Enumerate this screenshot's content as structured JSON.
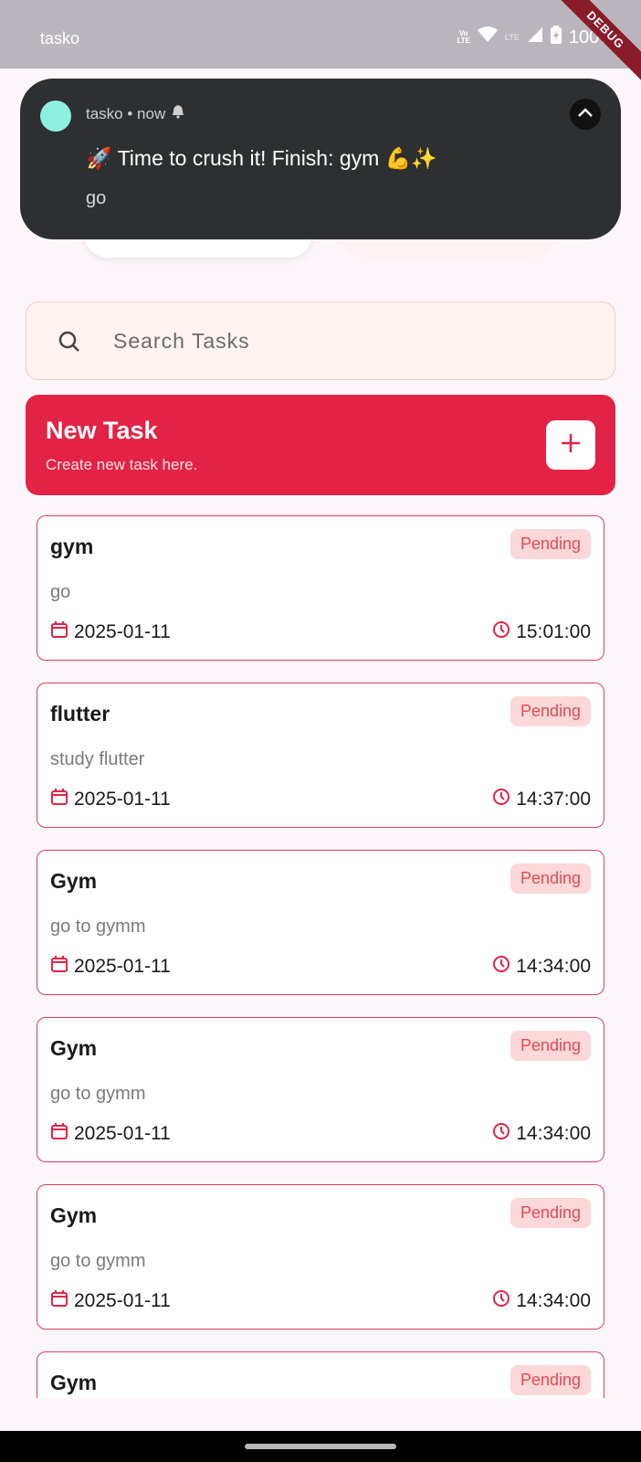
{
  "status_bar": {
    "app_name": "tasko",
    "battery": "100%",
    "volte_top": "Vo",
    "volte_bottom": "LTE",
    "lte_label": "LTE",
    "debug_label": "DEBUG"
  },
  "notification": {
    "meta": "tasko • now",
    "title": "🚀 Time to crush it! Finish: gym 💪✨",
    "body": "go",
    "avatar_color": "#8ef0df"
  },
  "search": {
    "placeholder": "Search Tasks"
  },
  "new_task": {
    "title": "New Task",
    "subtitle": "Create new task here."
  },
  "tasks": [
    {
      "title": "gym",
      "status": "Pending",
      "description": "go",
      "date": "2025-01-11",
      "time": "15:01:00"
    },
    {
      "title": "flutter",
      "status": "Pending",
      "description": "study flutter",
      "date": "2025-01-11",
      "time": "14:37:00"
    },
    {
      "title": "Gym",
      "status": "Pending",
      "description": "go to gymm",
      "date": "2025-01-11",
      "time": "14:34:00"
    },
    {
      "title": "Gym",
      "status": "Pending",
      "description": "go to gymm",
      "date": "2025-01-11",
      "time": "14:34:00"
    },
    {
      "title": "Gym",
      "status": "Pending",
      "description": "go to gymm",
      "date": "2025-01-11",
      "time": "14:34:00"
    },
    {
      "title": "Gym",
      "status": "Pending",
      "description": "",
      "date": "",
      "time": ""
    }
  ],
  "colors": {
    "accent": "#e22345",
    "card_border": "#dc3f5b",
    "badge_bg": "#fcd8d8",
    "badge_text": "#e14a57"
  },
  "icons": [
    "search-icon",
    "plus-icon",
    "calendar-icon",
    "clock-icon",
    "chevron-up-icon",
    "bell-icon",
    "wifi-icon",
    "signal-icon",
    "battery-icon"
  ]
}
